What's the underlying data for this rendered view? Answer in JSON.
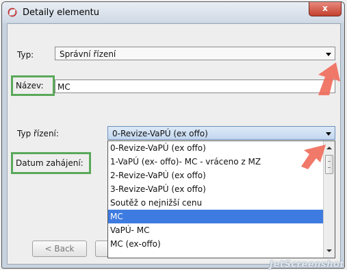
{
  "window": {
    "title": "Detaily elementu",
    "close_label": "x"
  },
  "fields": {
    "typ_label": "Typ:",
    "typ_value": "Správní řízení",
    "nazev_label": "Název:",
    "nazev_value": "MC",
    "typ_rizeni_label": "Typ řízení:",
    "typ_rizeni_value": "0-Revize-VaPÚ (ex offo)",
    "datum_label": "Datum zahájení:"
  },
  "dropdown": {
    "items": [
      "0-Revize-VaPÚ (ex offo)",
      "1-VaPÚ (ex- offo)- MC - vráceno z MZ",
      "2-Revize-VaPÚ (ex offo)",
      "3-Revize-VaPÚ (ex offo)",
      "Soutěž o nejnižší cenu",
      "MC",
      "VaPÚ- MC",
      "MC (ex-offo)"
    ],
    "selected_index": 5
  },
  "buttons": {
    "back_label": "< Back"
  },
  "watermark": "JetScreenshot"
}
